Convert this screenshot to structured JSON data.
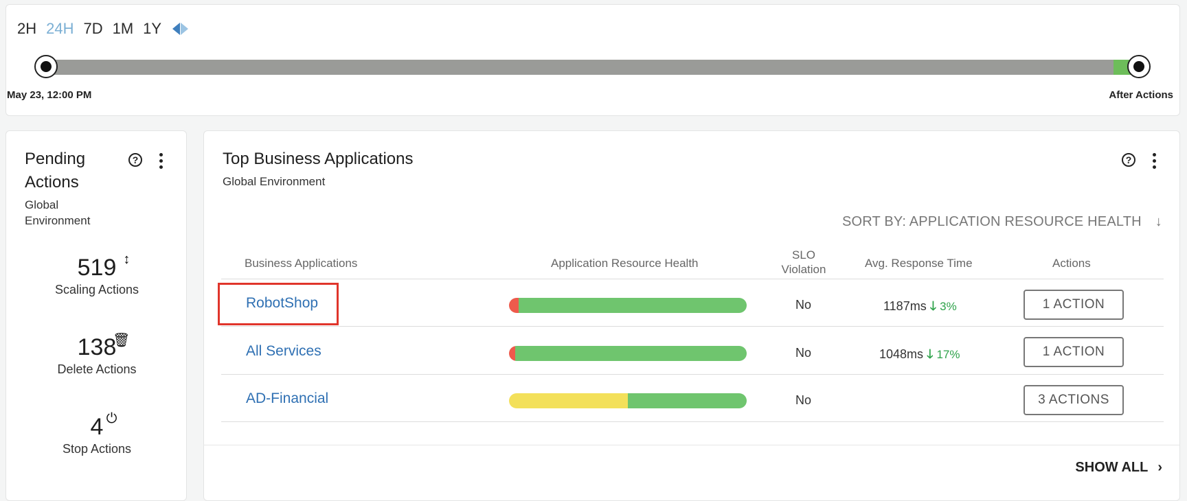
{
  "timeline": {
    "tabs": [
      "2H",
      "24H",
      "7D",
      "1M",
      "1Y"
    ],
    "active_tab": "24H",
    "start_label": "May 23, 12:00 PM",
    "end_label": "After Actions",
    "toggle_icon": "collapse-expand-icon"
  },
  "pending_actions": {
    "title_line1": "Pending",
    "title_line2": "Actions",
    "subtitle_line1": "Global",
    "subtitle_line2": "Environment",
    "help": "?",
    "stats": [
      {
        "value": "519",
        "label": "Scaling Actions",
        "icon": "scale-arrows-icon"
      },
      {
        "value": "138",
        "label": "Delete Actions",
        "icon": "trash-icon"
      },
      {
        "value": "4",
        "label": "Stop Actions",
        "icon": "power-icon"
      }
    ]
  },
  "top_apps": {
    "title": "Top Business Applications",
    "subtitle": "Global Environment",
    "help": "?",
    "sort_label": "SORT BY: APPLICATION RESOURCE HEALTH",
    "sort_arrow": "↓",
    "columns": {
      "app": "Business Applications",
      "health": "Application Resource Health",
      "slo_line1": "SLO",
      "slo_line2": "Violation",
      "response": "Avg. Response Time",
      "actions": "Actions"
    },
    "rows": [
      {
        "name": "RobotShop",
        "slo": "No",
        "response": "1187ms",
        "change": "3%",
        "action": "1 ACTION",
        "health": {
          "red": 0.04,
          "yellow": 0,
          "green": 0.96
        }
      },
      {
        "name": "All Services",
        "slo": "No",
        "response": "1048ms",
        "change": "17%",
        "action": "1 ACTION",
        "health": {
          "red": 0.025,
          "yellow": 0,
          "green": 0.975
        }
      },
      {
        "name": "AD-Financial",
        "slo": "No",
        "response": "",
        "change": "",
        "action": "3 ACTIONS",
        "health": {
          "red": 0,
          "yellow": 0.5,
          "green": 0.5
        }
      }
    ],
    "show_all": "SHOW ALL",
    "show_all_chevron": "›"
  },
  "colors": {
    "red": "#ee5a4c",
    "yellow": "#f3e05a",
    "green": "#6fc56e",
    "link": "#2f70b3",
    "highlight": "#e0352b"
  }
}
